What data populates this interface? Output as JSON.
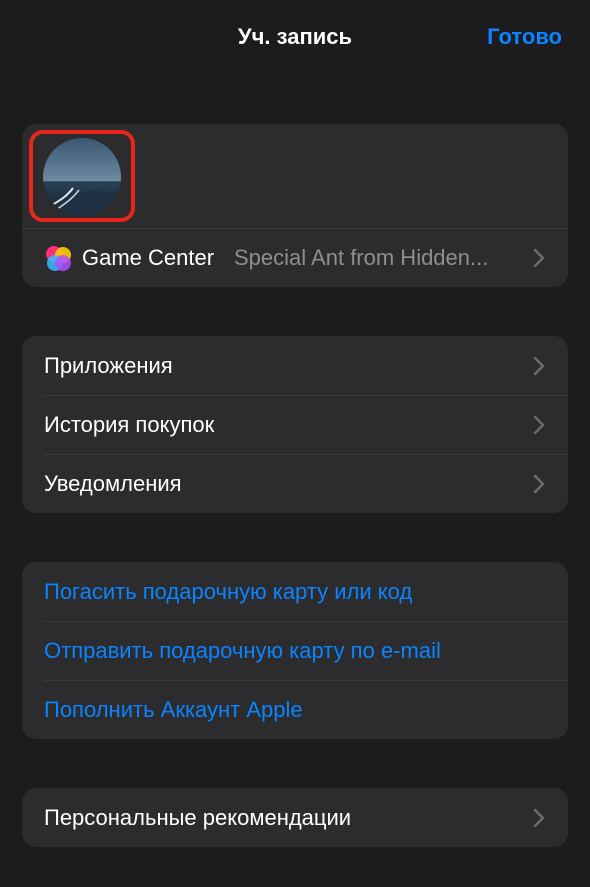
{
  "header": {
    "title": "Уч. запись",
    "done_label": "Готово"
  },
  "account": {
    "avatar_icon": "avatar-photo-icon",
    "game_center": {
      "label": "Game Center",
      "value": "Special Ant from Hidden...",
      "icon": "game-center-icon"
    }
  },
  "menu": {
    "items": [
      {
        "label": "Приложения"
      },
      {
        "label": "История покупок"
      },
      {
        "label": "Уведомления"
      }
    ]
  },
  "gift": {
    "items": [
      {
        "label": "Погасить подарочную карту или код"
      },
      {
        "label": "Отправить подарочную карту по e-mail"
      },
      {
        "label": "Пополнить Аккаунт Apple"
      }
    ]
  },
  "recommendations": {
    "label": "Персональные рекомендации"
  },
  "colors": {
    "background": "#1c1c1e",
    "card": "#2c2c2e",
    "accent": "#0a84ff",
    "highlight": "#e8261b",
    "secondary_text": "#8e8e93"
  }
}
